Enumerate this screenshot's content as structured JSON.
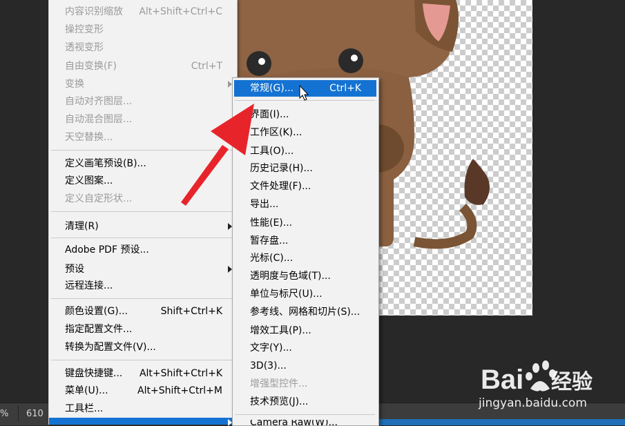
{
  "status_bar": {
    "zoom": "%",
    "doc_info": "610"
  },
  "main_menu": {
    "items": [
      {
        "label": "内容识别缩放",
        "shortcut": "Alt+Shift+Ctrl+C",
        "disabled": true
      },
      {
        "label": "操控变形",
        "shortcut": "",
        "disabled": true
      },
      {
        "label": "透视变形",
        "shortcut": "",
        "disabled": true
      },
      {
        "label": "自由变换(F)",
        "shortcut": "Ctrl+T",
        "disabled": true
      },
      {
        "label": "变换",
        "shortcut": "",
        "disabled": true,
        "submenu": true
      },
      {
        "label": "自动对齐图层...",
        "shortcut": "",
        "disabled": true
      },
      {
        "label": "自动混合图层...",
        "shortcut": "",
        "disabled": true
      },
      {
        "label": "天空替换...",
        "shortcut": "",
        "disabled": true
      },
      {
        "label": "定义画笔预设(B)...",
        "shortcut": "",
        "disabled": false
      },
      {
        "label": "定义图案...",
        "shortcut": "",
        "disabled": false
      },
      {
        "label": "定义自定形状...",
        "shortcut": "",
        "disabled": true
      },
      {
        "label": "清理(R)",
        "shortcut": "",
        "disabled": false,
        "submenu": true
      },
      {
        "label": "Adobe PDF 预设...",
        "shortcut": "",
        "disabled": false
      },
      {
        "label": "预设",
        "shortcut": "",
        "disabled": false,
        "submenu": true
      },
      {
        "label": "远程连接...",
        "shortcut": "",
        "disabled": false
      },
      {
        "label": "颜色设置(G)...",
        "shortcut": "Shift+Ctrl+K",
        "disabled": false
      },
      {
        "label": "指定配置文件...",
        "shortcut": "",
        "disabled": false
      },
      {
        "label": "转换为配置文件(V)...",
        "shortcut": "",
        "disabled": false
      },
      {
        "label": "键盘快捷键...",
        "shortcut": "Alt+Shift+Ctrl+K",
        "disabled": false
      },
      {
        "label": "菜单(U)...",
        "shortcut": "Alt+Shift+Ctrl+M",
        "disabled": false
      },
      {
        "label": "工具栏...",
        "shortcut": "",
        "disabled": false
      },
      {
        "label": "",
        "shortcut": "",
        "disabled": false,
        "submenu": true,
        "highlighted": true
      }
    ]
  },
  "preferences_submenu": {
    "items": [
      {
        "label": "常规(G)...",
        "shortcut": "Ctrl+K",
        "highlighted": true
      },
      {
        "label": "界面(I)...",
        "shortcut": ""
      },
      {
        "label": "工作区(K)...",
        "shortcut": ""
      },
      {
        "label": "工具(O)...",
        "shortcut": ""
      },
      {
        "label": "历史记录(H)...",
        "shortcut": ""
      },
      {
        "label": "文件处理(F)...",
        "shortcut": ""
      },
      {
        "label": "导出...",
        "shortcut": ""
      },
      {
        "label": "性能(E)...",
        "shortcut": ""
      },
      {
        "label": "暂存盘...",
        "shortcut": ""
      },
      {
        "label": "光标(C)...",
        "shortcut": ""
      },
      {
        "label": "透明度与色域(T)...",
        "shortcut": ""
      },
      {
        "label": "单位与标尺(U)...",
        "shortcut": ""
      },
      {
        "label": "参考线、网格和切片(S)...",
        "shortcut": ""
      },
      {
        "label": "增效工具(P)...",
        "shortcut": ""
      },
      {
        "label": "文字(Y)...",
        "shortcut": ""
      },
      {
        "label": "3D(3)...",
        "shortcut": ""
      },
      {
        "label": "增强型控件...",
        "shortcut": "",
        "disabled": true
      },
      {
        "label": "技术预览(J)...",
        "shortcut": ""
      },
      {
        "label": "Camera Raw(W)...",
        "shortcut": ""
      }
    ]
  },
  "watermark": {
    "brand": "Bai du 经验",
    "url": "jingyan.baidu.com"
  },
  "colors": {
    "highlight": "#1473d2",
    "arrow": "#e8242b",
    "menu_bg": "#f2f2f2"
  }
}
